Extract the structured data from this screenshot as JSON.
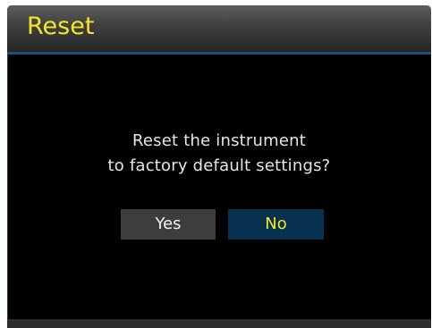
{
  "dialog": {
    "title": "Reset",
    "message_line1": "Reset the instrument",
    "message_line2": "to factory default settings?",
    "yes_label": "Yes",
    "no_label": "No",
    "selected_button": "No"
  },
  "colors": {
    "title_text": "#f5e623",
    "selected_button_bg": "#08324f",
    "unselected_button_bg": "#3d3d3d",
    "background": "#000000",
    "accent_line": "#1d4f7a"
  }
}
